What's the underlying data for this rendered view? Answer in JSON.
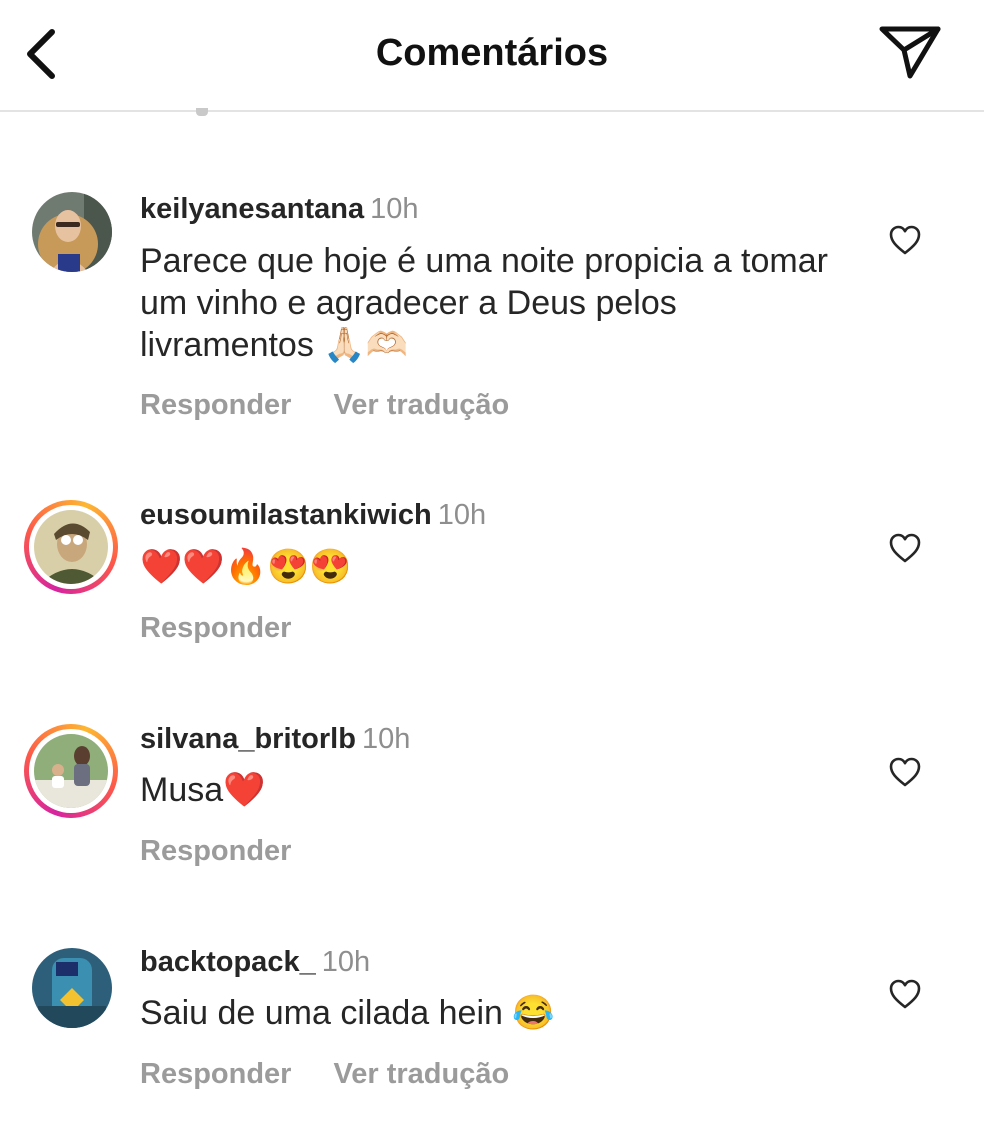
{
  "header": {
    "title": "Comentários"
  },
  "comments": [
    {
      "username": "keilyanesantana",
      "time": "10h",
      "text": "Parece que hoje é uma noite propicia a tomar um vinho e agradecer a Deus pelos livramentos 🙏🏻🫶🏻",
      "reply_label": "Responder",
      "translate_label": "Ver tradução"
    },
    {
      "username": "eusoumilastankiwich",
      "time": "10h",
      "text": "❤️❤️🔥😍😍",
      "reply_label": "Responder"
    },
    {
      "username": "silvana_britorlb",
      "time": "10h",
      "text": "Musa❤️",
      "reply_label": "Responder"
    },
    {
      "username": "backtopack_",
      "time": "10h",
      "text": "Saiu de uma cilada hein 😂",
      "reply_label": "Responder",
      "translate_label": "Ver tradução"
    }
  ],
  "colors": {
    "text": "#262626",
    "secondary": "#8e8e8e",
    "action": "#9b9b9b",
    "divider": "#e3e3e3"
  },
  "icons": {
    "back": "chevron-left-icon",
    "share": "paper-plane-icon",
    "like": "heart-outline-icon"
  }
}
